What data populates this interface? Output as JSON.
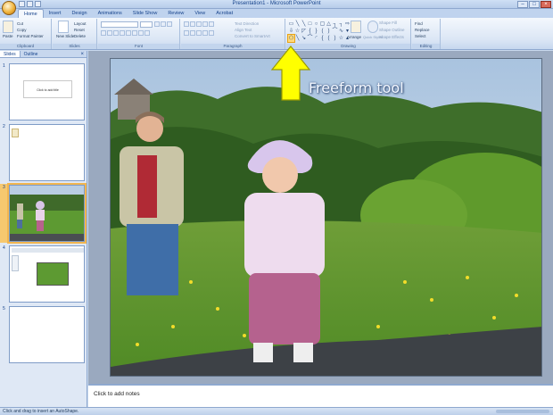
{
  "window": {
    "title": "Presentation1 - Microsoft PowerPoint"
  },
  "tabs": [
    "Home",
    "Insert",
    "Design",
    "Animations",
    "Slide Show",
    "Review",
    "View",
    "Acrobat"
  ],
  "ribbon": {
    "clipboard": {
      "label": "Clipboard",
      "paste": "Paste",
      "cut": "Cut",
      "copy": "Copy",
      "format_painter": "Format Painter"
    },
    "slides": {
      "label": "Slides",
      "new_slide": "New Slide",
      "layout": "Layout",
      "reset": "Reset",
      "delete": "Delete"
    },
    "font": {
      "label": "Font"
    },
    "paragraph": {
      "label": "Paragraph",
      "text_direction": "Text Direction",
      "align_text": "Align Text",
      "convert": "Convert to SmartArt"
    },
    "drawing": {
      "label": "Drawing",
      "arrange": "Arrange",
      "quick_styles": "Quick Styles",
      "shape_fill": "Shape Fill",
      "shape_outline": "Shape Outline",
      "shape_effects": "Shape Effects"
    },
    "editing": {
      "label": "Editing",
      "find": "Find",
      "replace": "Replace",
      "select": "Select"
    }
  },
  "pane": {
    "tab_slides": "Slides",
    "tab_outline": "Outline",
    "close": "×",
    "thumb_title": "Click to add title",
    "slide_numbers": [
      "1",
      "2",
      "3",
      "4",
      "5"
    ]
  },
  "callout": {
    "text": "Freeform tool",
    "color": "#ffff00"
  },
  "notes": {
    "placeholder": "Click to add notes"
  },
  "status": {
    "text": "Click and drag to insert an AutoShape."
  }
}
